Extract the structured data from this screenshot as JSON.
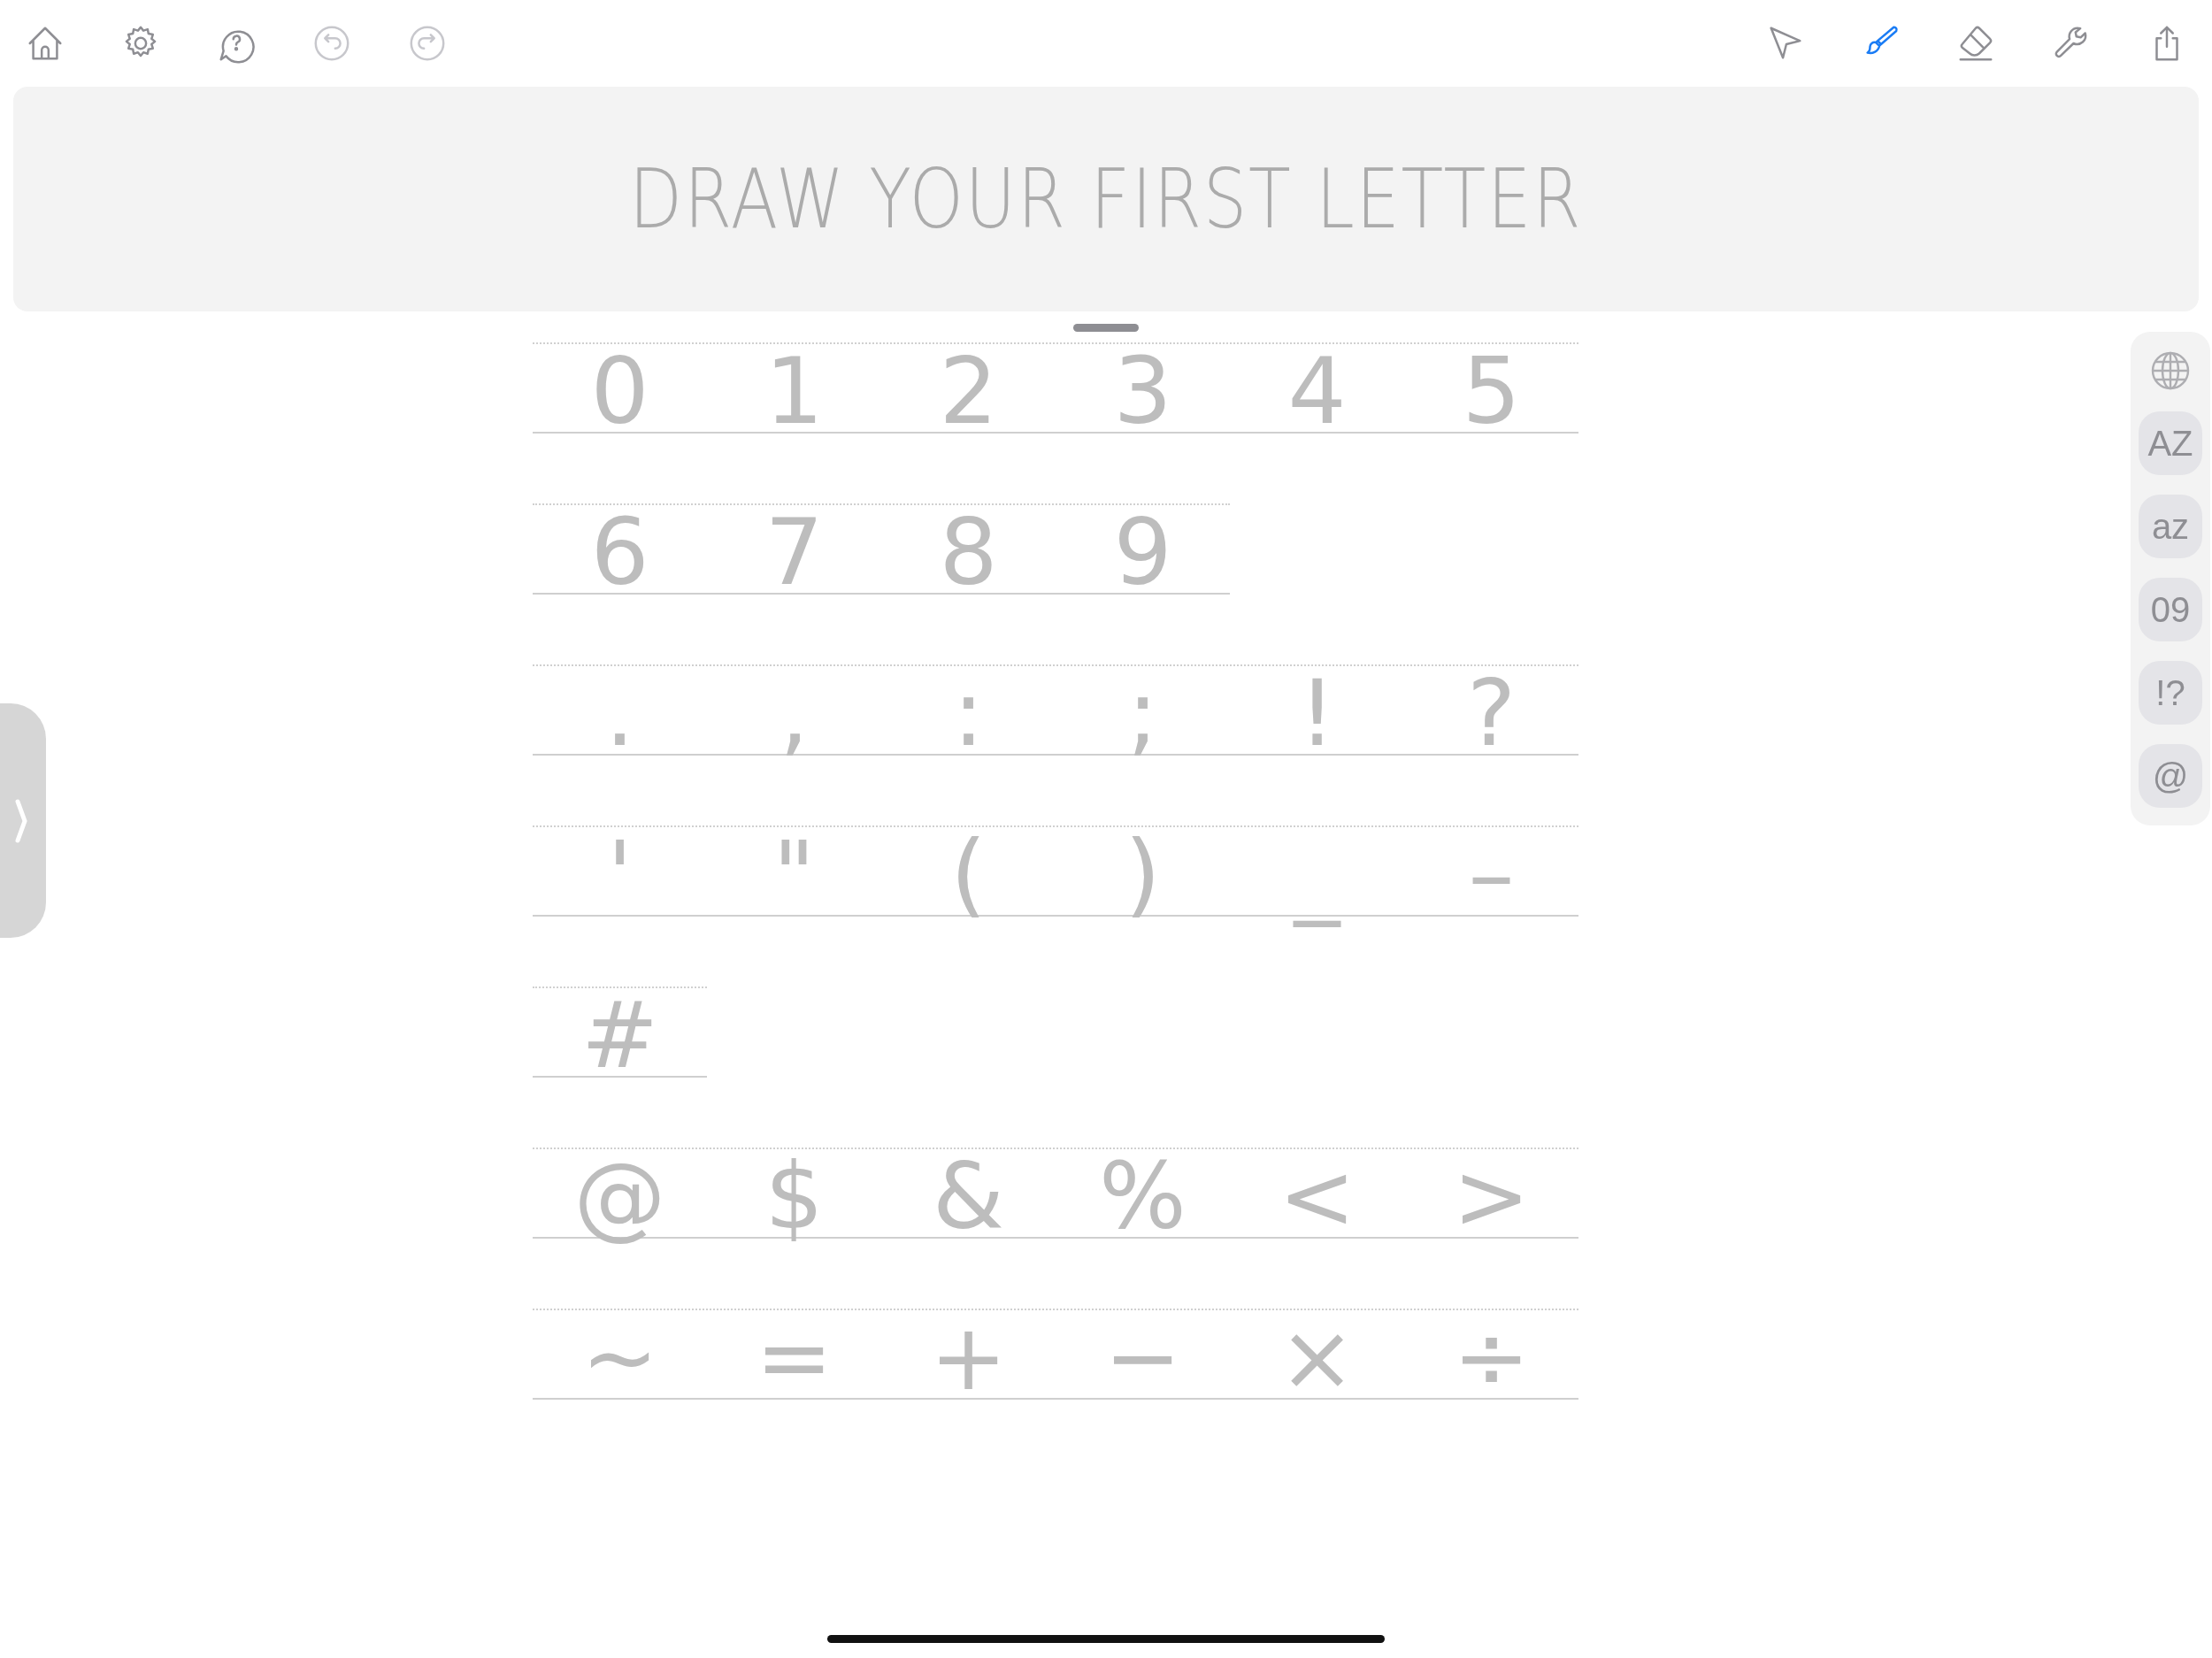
{
  "toolbar": {
    "left": [
      {
        "kind": "home",
        "disabled": false
      },
      {
        "kind": "settings",
        "disabled": false
      },
      {
        "kind": "help",
        "disabled": false
      },
      {
        "kind": "undo",
        "disabled": true
      },
      {
        "kind": "redo",
        "disabled": true
      }
    ],
    "right": [
      {
        "kind": "pointer",
        "selected": false
      },
      {
        "kind": "brush",
        "selected": true
      },
      {
        "kind": "eraser",
        "selected": false
      },
      {
        "kind": "wrench",
        "selected": false
      },
      {
        "kind": "share",
        "selected": false
      }
    ]
  },
  "banner": {
    "prompt": "DRAW YOUR FIRST LETTER"
  },
  "glyph_rows": [
    [
      "0",
      "1",
      "2",
      "3",
      "4",
      "5"
    ],
    [
      "6",
      "7",
      "8",
      "9"
    ],
    [
      ".",
      ",",
      ":",
      ";",
      "!",
      "?"
    ],
    [
      "'",
      "\"",
      "(",
      ")",
      "_",
      "–"
    ],
    [
      "#"
    ],
    [
      "@",
      "$",
      "&",
      "%",
      "<",
      ">"
    ],
    [
      "~",
      "=",
      "+",
      "−",
      "×",
      "÷"
    ]
  ],
  "categories": [
    {
      "kind": "globe"
    },
    {
      "kind": "label",
      "label": "AZ"
    },
    {
      "kind": "label",
      "label": "az"
    },
    {
      "kind": "label",
      "label": "09"
    },
    {
      "kind": "label",
      "label": "!?"
    },
    {
      "kind": "label",
      "label": "@"
    }
  ]
}
